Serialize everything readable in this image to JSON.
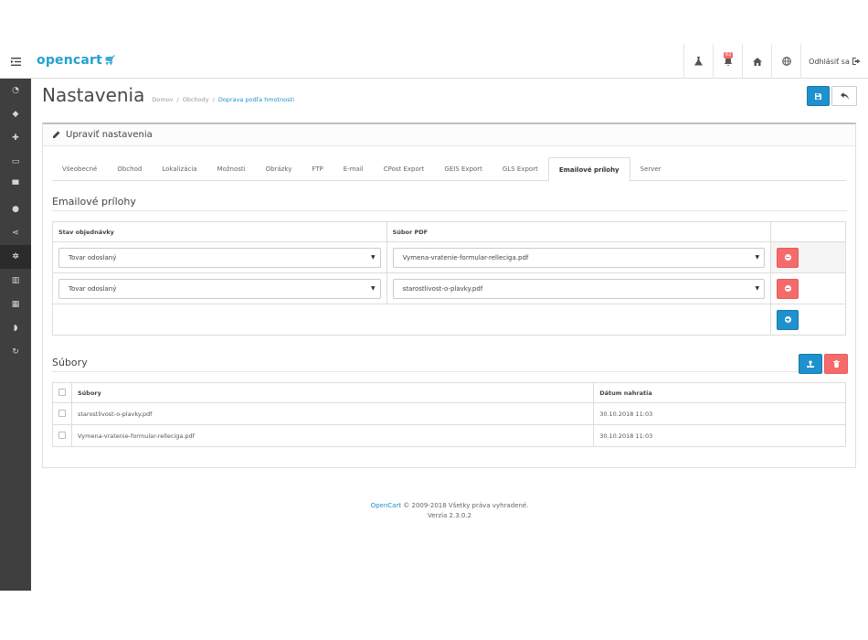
{
  "header": {
    "logo_text": "opencart",
    "logout_label": "Odhlásiť sa",
    "notification_count": "62",
    "icons": [
      "flask-icon",
      "bell-icon",
      "home-icon",
      "globe-icon",
      "sign-out-icon"
    ]
  },
  "sidebar": {
    "items": [
      "dashboard-icon",
      "tags-icon",
      "puzzle-icon",
      "desktop-icon",
      "shopping-cart-icon",
      "user-icon",
      "share-icon",
      "cog-icon",
      "bar-chart-icon",
      "table-icon",
      "shield-icon",
      "refresh-icon"
    ],
    "active_index": 7
  },
  "page": {
    "title": "Nastavenia",
    "breadcrumb": [
      "Domov",
      "Obchody",
      "Doprava podľa hmotnosti"
    ]
  },
  "panel": {
    "heading": "Upraviť nastavenia"
  },
  "tabs": [
    "Všeobecné",
    "Obchod",
    "Lokalizácia",
    "Možnosti",
    "Obrázky",
    "FTP",
    "E-mail",
    "CPost Export",
    "GEIS Export",
    "GLS Export",
    "Emailové prílohy",
    "Server"
  ],
  "active_tab": "Emailové prílohy",
  "attachments": {
    "title": "Emailové prílohy",
    "col_status": "Stav objednávky",
    "col_pdf": "Súbor PDF",
    "rows": [
      {
        "status": "Tovar odoslaný",
        "pdf": "Vymena-vratenie-formular-relleciga.pdf"
      },
      {
        "status": "Tovar odoslaný",
        "pdf": "starostlivost-o-plavky.pdf"
      }
    ]
  },
  "files": {
    "title": "Súbory",
    "col_file": "Súbory",
    "col_date": "Dátum nahratia",
    "rows": [
      {
        "name": "starostlivost-o-plavky.pdf",
        "date": "30.10.2018 11:03"
      },
      {
        "name": "Vymena-vratenie-formular-relleciga.pdf",
        "date": "30.10.2018 11:03"
      }
    ]
  },
  "footer": {
    "brand": "OpenCart",
    "copyright": "© 2009-2018 Všetky práva vyhradené.",
    "version": "Verzia 2.3.0.2"
  },
  "colors": {
    "primary": "#1e91cf",
    "danger": "#f56b6b",
    "sidebar": "#3f3f3f"
  }
}
